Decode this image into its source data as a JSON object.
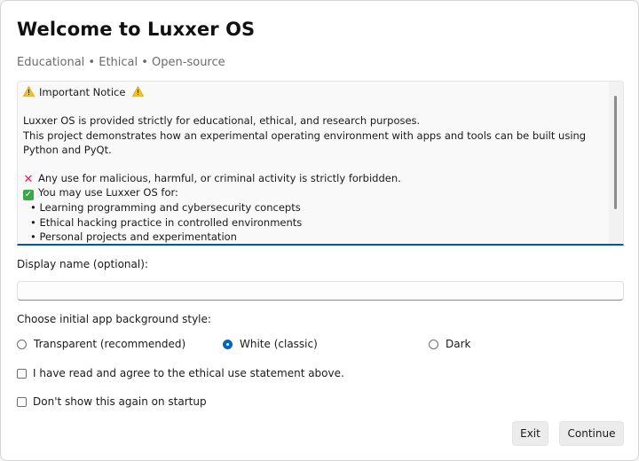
{
  "dialog": {
    "title": "Welcome to Luxxer OS",
    "subtitle": "Educational • Ethical • Open-source"
  },
  "notice": {
    "heading": "Important Notice",
    "para1": "Luxxer OS is provided strictly for educational, ethical, and research purposes.",
    "para2": "This project demonstrates how an experimental operating environment with apps and tools can be built using Python and PyQt.",
    "forbidden": "Any use for malicious, harmful, or criminal activity is strictly forbidden.",
    "allowed": "You may use Luxxer OS for:",
    "uses": [
      "• Learning programming and cybersecurity concepts",
      "• Ethical hacking practice in controlled environments",
      "• Personal projects and experimentation"
    ]
  },
  "display_name": {
    "label": "Display name (optional):",
    "value": ""
  },
  "background_style": {
    "label": "Choose initial app background style:",
    "options": [
      "Transparent (recommended)",
      "White (classic)",
      "Dark"
    ],
    "selected": "White (classic)"
  },
  "agree_label": "I have read and agree to the ethical use statement above.",
  "dont_show_label": "Don't show this again on startup",
  "buttons": {
    "exit": "Exit",
    "continue": "Continue"
  },
  "colors": {
    "accent": "#0067c0",
    "focus_underline": "#005a9e",
    "cross": "#e0245e",
    "check": "#3aa84a",
    "warning": "#f2c21b"
  }
}
